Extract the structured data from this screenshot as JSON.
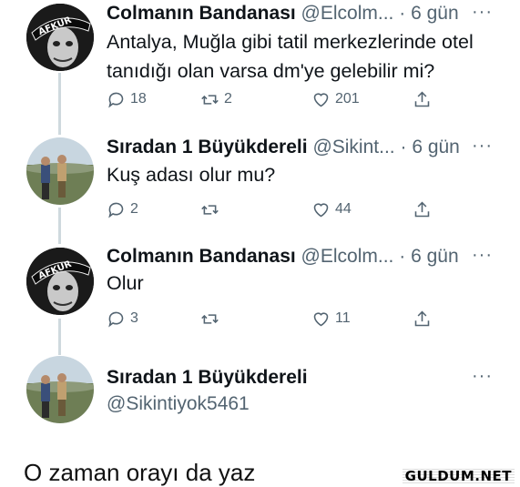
{
  "tweets": [
    {
      "display_name": "Colmanın Bandanası",
      "handle": "@Elcolm...",
      "separator": "·",
      "time": "6 gün",
      "more": "···",
      "avatar_text": "AFKUR",
      "text_lines": [
        "Antalya, Muğla gibi tatil merkezlerinde otel",
        "tanıdığı olan varsa dm'ye gelebilir mi?"
      ],
      "replies": "18",
      "retweets": "2",
      "likes": "201"
    },
    {
      "display_name": "Sıradan 1 Büyükdereli",
      "handle": "@Sikint...",
      "separator": "·",
      "time": "6 gün",
      "more": "···",
      "text_lines": [
        "Kuş adası olur mu?"
      ],
      "replies": "2",
      "retweets": "",
      "likes": "44"
    },
    {
      "display_name": "Colmanın Bandanası",
      "handle": "@Elcolm...",
      "separator": "·",
      "time": "6 gün",
      "more": "···",
      "avatar_text": "AFKUR",
      "text_lines": [
        "Olur"
      ],
      "replies": "3",
      "retweets": "",
      "likes": "11"
    },
    {
      "display_name": "Sıradan 1 Büyükdereli",
      "handle": "@Sikintiyok5461",
      "more": "···"
    }
  ],
  "caption": "O zaman orayı da yaz",
  "watermark": "GULDUM.NET",
  "colors": {
    "text": "#0f1419",
    "muted": "#536471",
    "thread": "#cfd9de"
  }
}
